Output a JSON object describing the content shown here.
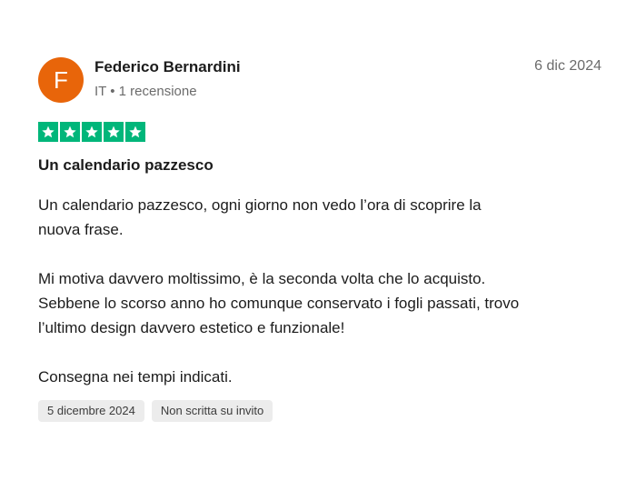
{
  "review": {
    "avatar_initial": "F",
    "reviewer_name": "Federico Bernardini",
    "country": "IT",
    "separator": "•",
    "review_count": "1 recensione",
    "date": "6 dic 2024",
    "rating": 5,
    "title": "Un calendario pazzesco",
    "paragraphs": [
      "Un calendario pazzesco, ogni giorno non vedo l’ora di scoprire la\nnuova frase.",
      "Mi motiva davvero moltissimo, è la seconda volta che lo acquisto.\nSebbene lo scorso anno ho comunque conservato i fogli passati, trovo\nl’ultimo design davvero estetico e funzionale!",
      "Consegna nei tempi indicati."
    ],
    "tags": {
      "experience_date": "5 dicembre 2024",
      "invitation_status": "Non scritta su invito"
    }
  },
  "colors": {
    "avatar_bg": "#e8650a",
    "star_bg": "#00b67a",
    "tag_bg": "#ececec"
  },
  "icons": {
    "star": "star-icon"
  }
}
